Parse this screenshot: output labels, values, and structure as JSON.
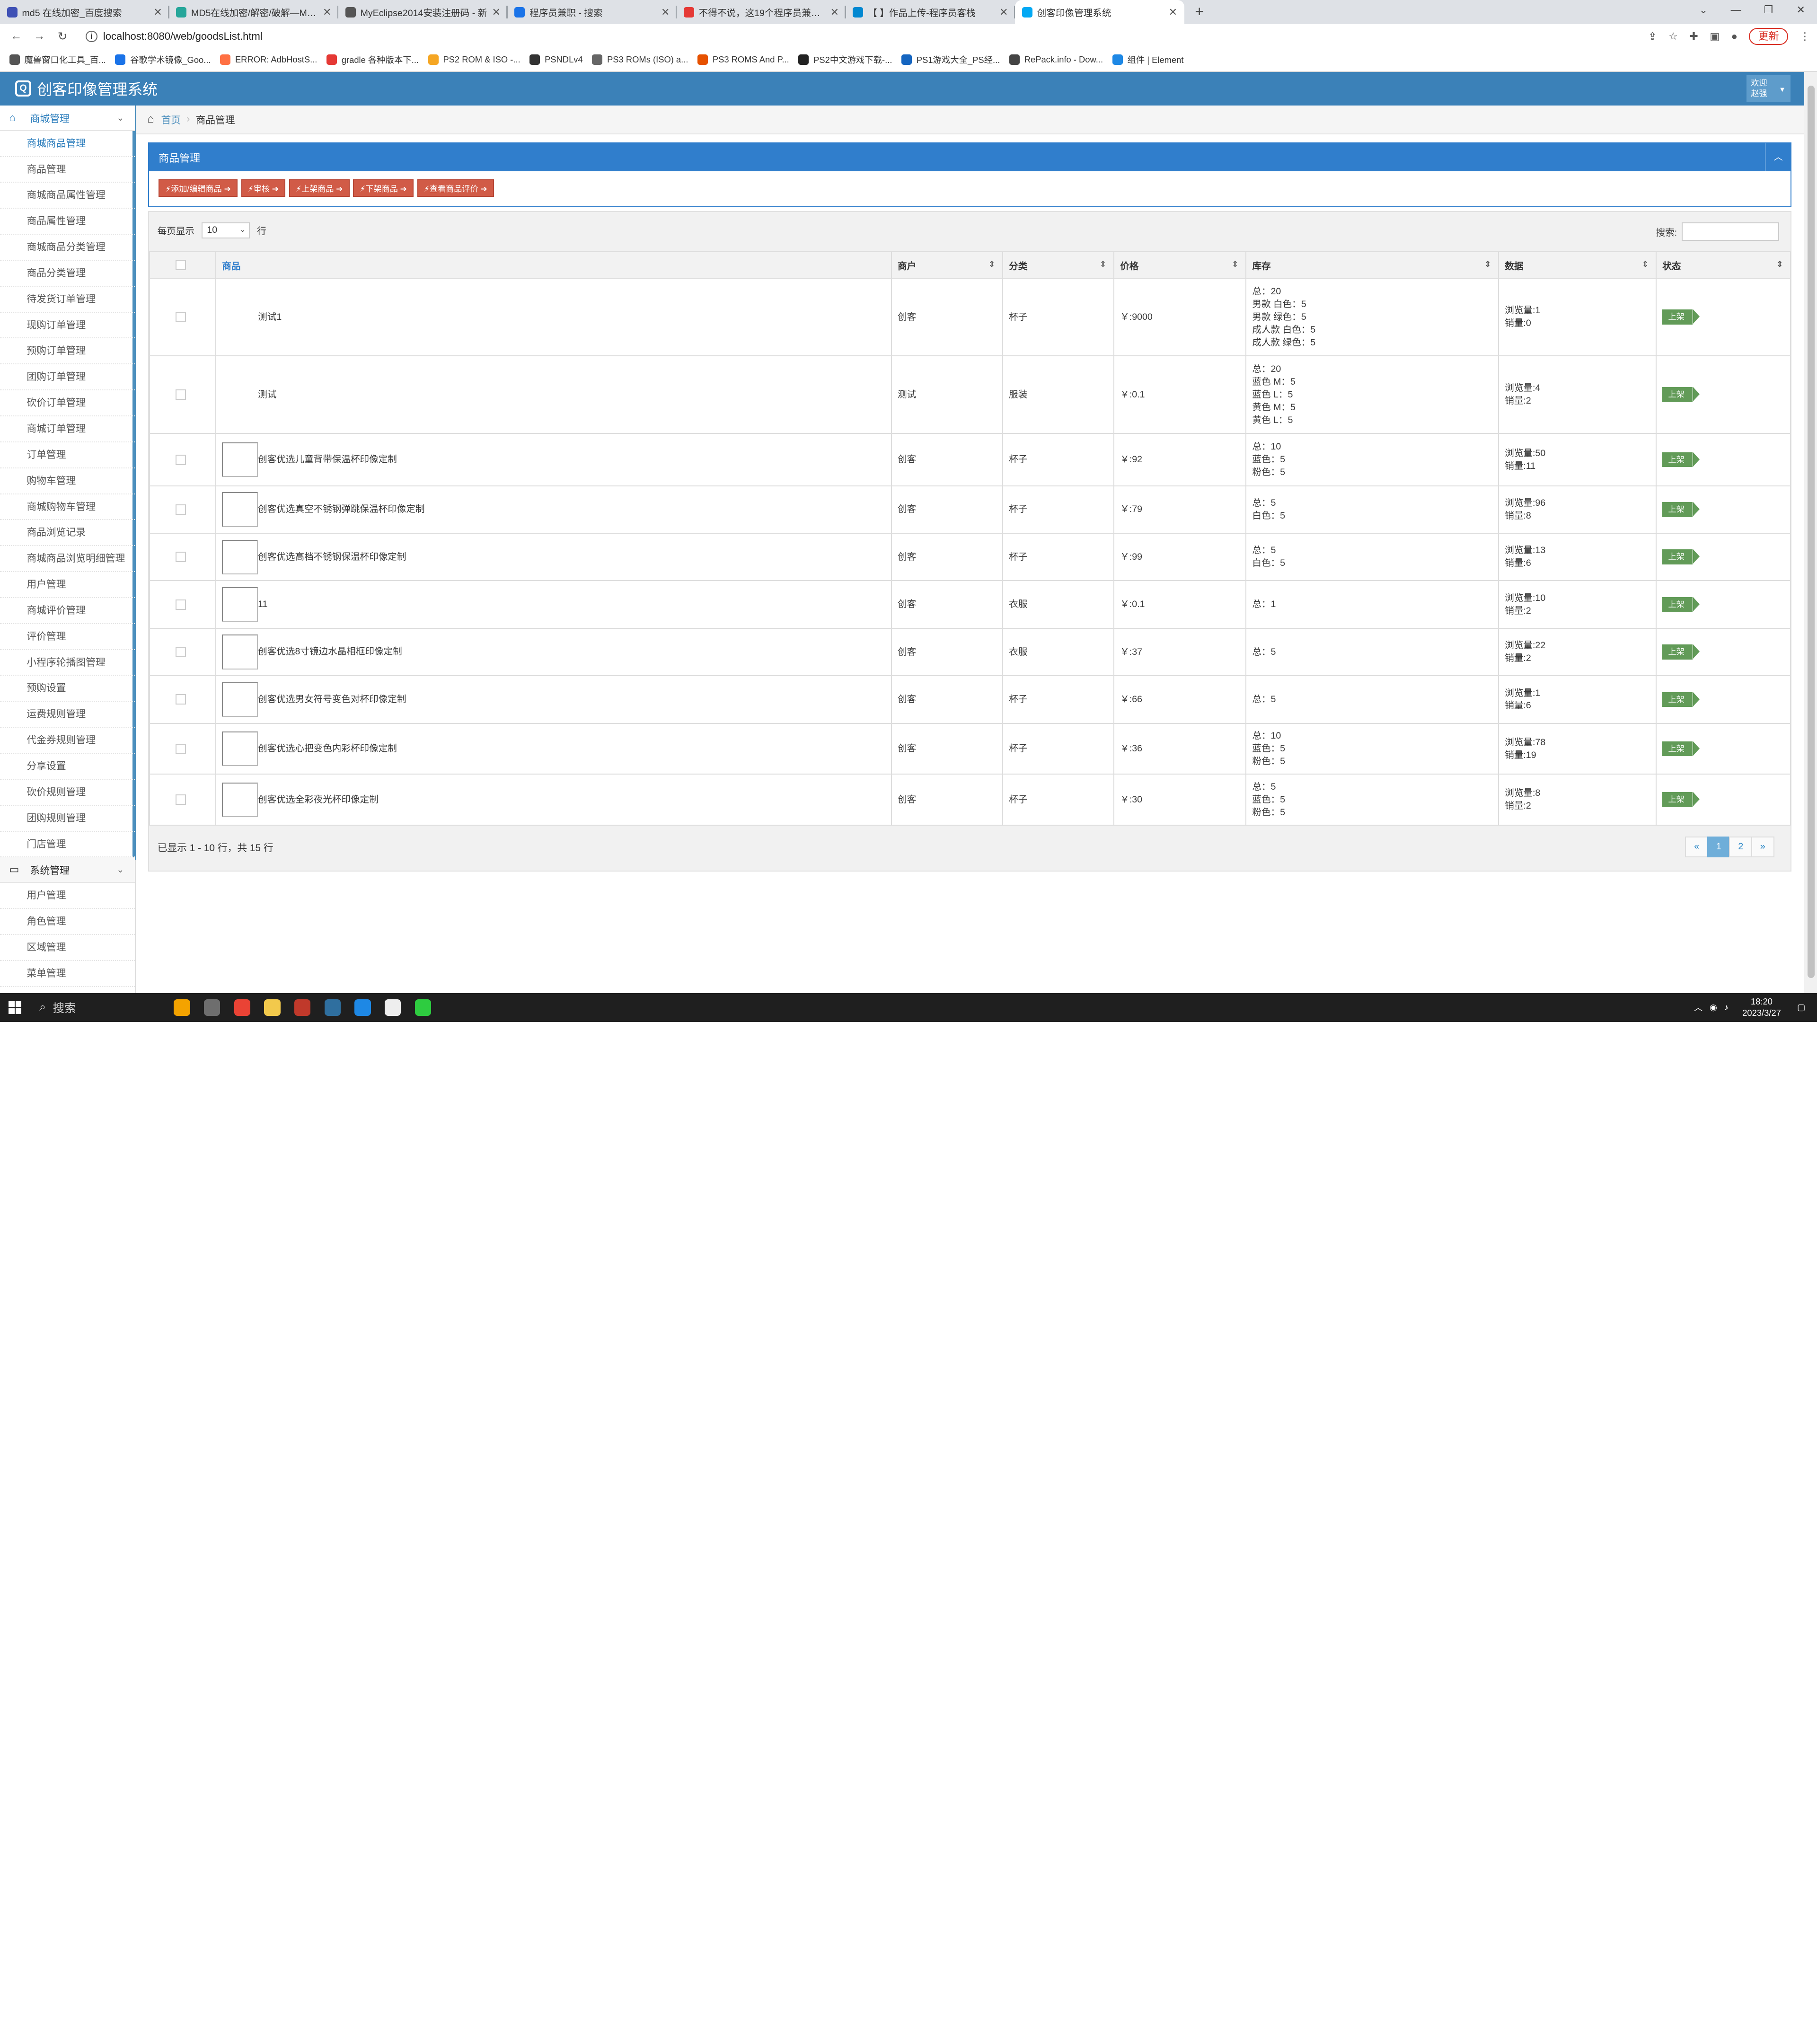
{
  "browser": {
    "tabs": [
      {
        "title": "md5 在线加密_百度搜索",
        "color": "#3f51b5"
      },
      {
        "title": "MD5在线加密/解密/破解—MD5",
        "color": "#26a69a"
      },
      {
        "title": "MyEclipse2014安装注册码 - 新",
        "color": "#555555"
      },
      {
        "title": "程序员兼职 - 搜索",
        "color": "#1a73e8"
      },
      {
        "title": "不得不说，这19个程序员兼职平",
        "color": "#e53935"
      },
      {
        "title": "【  】作品上传-程序员客栈",
        "color": "#0288d1"
      },
      {
        "title": "创客印像管理系统",
        "color": "#03a9f4"
      }
    ],
    "new_tab": "+",
    "url": "localhost:8080/web/goodsList.html",
    "update_label": "更新",
    "bookmarks": [
      {
        "label": "魔兽窗口化工具_百...",
        "color": "#555555"
      },
      {
        "label": "谷歌学术镜像_Goo...",
        "color": "#1a73e8"
      },
      {
        "label": "ERROR: AdbHostS...",
        "color": "#ff7043"
      },
      {
        "label": "gradle 各种版本下...",
        "color": "#e53935"
      },
      {
        "label": "PS2 ROM & ISO -...",
        "color": "#f5a623"
      },
      {
        "label": "PSNDLv4",
        "color": "#333333"
      },
      {
        "label": "PS3 ROMs (ISO) a...",
        "color": "#666666"
      },
      {
        "label": "PS3 ROMS And P...",
        "color": "#e65100"
      },
      {
        "label": "PS2中文游戏下载-...",
        "color": "#222222"
      },
      {
        "label": "PS1游戏大全_PS经...",
        "color": "#1565c0"
      },
      {
        "label": "RePack.info - Dow...",
        "color": "#444444"
      },
      {
        "label": "组件 | Element",
        "color": "#1e88e5"
      }
    ]
  },
  "app": {
    "title": "创客印像管理系统",
    "welcome_line1": "欢迎",
    "welcome_line2": "赵强"
  },
  "sidebar": {
    "group1": "商城管理",
    "items": [
      "商城商品管理",
      "商品管理",
      "商城商品属性管理",
      "商品属性管理",
      "商城商品分类管理",
      "商品分类管理",
      "待发货订单管理",
      "现购订单管理",
      "预购订单管理",
      "团购订单管理",
      "砍价订单管理",
      "商城订单管理",
      "订单管理",
      "购物车管理",
      "商城购物车管理",
      "商品浏览记录",
      "商城商品浏览明细管理",
      "用户管理",
      "商城评价管理",
      "评价管理",
      "小程序轮播图管理",
      "预购设置",
      "运费规则管理",
      "代金券规则管理",
      "分享设置",
      "砍价规则管理",
      "团购规则管理",
      "门店管理"
    ],
    "group2": "系统管理",
    "items2": [
      "用户管理",
      "角色管理",
      "区域管理",
      "菜单管理"
    ]
  },
  "breadcrumb": {
    "home": "首页",
    "current": "商品管理"
  },
  "widget": {
    "title": "商品管理",
    "buttons": [
      "添加/编辑商品",
      "审核",
      "上架商品",
      "下架商品",
      "查看商品评价"
    ]
  },
  "grid": {
    "length_label_pre": "每页显示",
    "length_value": "10",
    "length_label_post": "行",
    "search_label": "搜索:",
    "columns": [
      "商品",
      "商户",
      "分类",
      "价格",
      "库存",
      "数据",
      "状态"
    ],
    "rows": [
      {
        "name": "测试1",
        "merchant": "创客",
        "category": "杯子",
        "price": "￥:9000",
        "stock": [
          "总：20",
          "男款 白色：5",
          "男款 绿色：5",
          "成人款 白色：5",
          "成人款 绿色：5"
        ],
        "data": [
          "浏览量:1",
          "销量:0"
        ],
        "status": "上架",
        "img": false
      },
      {
        "name": "测试",
        "merchant": "测试",
        "category": "服装",
        "price": "￥:0.1",
        "stock": [
          "总：20",
          "蓝色 M：5",
          "蓝色 L：5",
          "黄色 M：5",
          "黄色 L：5"
        ],
        "data": [
          "浏览量:4",
          "销量:2"
        ],
        "status": "上架",
        "img": false
      },
      {
        "name": "创客优选儿童背带保温杯印像定制",
        "merchant": "创客",
        "category": "杯子",
        "price": "￥:92",
        "stock": [
          "总：10",
          "蓝色：5",
          "粉色：5"
        ],
        "data": [
          "浏览量:50",
          "销量:11"
        ],
        "status": "上架",
        "img": true
      },
      {
        "name": "创客优选真空不锈钢弹跳保温杯印像定制",
        "merchant": "创客",
        "category": "杯子",
        "price": "￥:79",
        "stock": [
          "总：5",
          "白色：5"
        ],
        "data": [
          "浏览量:96",
          "销量:8"
        ],
        "status": "上架",
        "img": true
      },
      {
        "name": "创客优选高档不锈钢保温杯印像定制",
        "merchant": "创客",
        "category": "杯子",
        "price": "￥:99",
        "stock": [
          "总：5",
          "白色：5"
        ],
        "data": [
          "浏览量:13",
          "销量:6"
        ],
        "status": "上架",
        "img": true
      },
      {
        "name": "11",
        "merchant": "创客",
        "category": "衣服",
        "price": "￥:0.1",
        "stock": [
          "总：1"
        ],
        "data": [
          "浏览量:10",
          "销量:2"
        ],
        "status": "上架",
        "img": true
      },
      {
        "name": "创客优选8寸镜边水晶相框印像定制",
        "merchant": "创客",
        "category": "衣服",
        "price": "￥:37",
        "stock": [
          "总：5"
        ],
        "data": [
          "浏览量:22",
          "销量:2"
        ],
        "status": "上架",
        "img": true
      },
      {
        "name": "创客优选男女符号变色对杯印像定制",
        "merchant": "创客",
        "category": "杯子",
        "price": "￥:66",
        "stock": [
          "总：5"
        ],
        "data": [
          "浏览量:1",
          "销量:6"
        ],
        "status": "上架",
        "img": true
      },
      {
        "name": "创客优选心把变色内彩杯印像定制",
        "merchant": "创客",
        "category": "杯子",
        "price": "￥:36",
        "stock": [
          "总：10",
          "蓝色：5",
          "粉色：5"
        ],
        "data": [
          "浏览量:78",
          "销量:19"
        ],
        "status": "上架",
        "img": true
      },
      {
        "name": "创客优选全彩夜光杯印像定制",
        "merchant": "创客",
        "category": "杯子",
        "price": "￥:30",
        "stock": [
          "总：5",
          "蓝色：5",
          "粉色：5"
        ],
        "data": [
          "浏览量:8",
          "销量:2"
        ],
        "status": "上架",
        "img": true
      }
    ],
    "info": "已显示 1 - 10 行，共 15 行",
    "pager": [
      "«",
      "1",
      "2",
      "»"
    ],
    "pager_current": "1"
  },
  "taskbar": {
    "search": "搜索",
    "apps": [
      "#f4a300",
      "#6e6e6e",
      "#ea4335",
      "#f2c94c",
      "#c0392b",
      "#2f6f9f",
      "#1e88e5",
      "#eeeeee",
      "#2ecc40"
    ],
    "time": "18:20",
    "date": "2023/3/27"
  },
  "colors": {
    "header": "#3b81b8",
    "widget": "#307ecc",
    "danger": "#d15b47",
    "success": "#629b58",
    "link": "#4c8fbd"
  }
}
